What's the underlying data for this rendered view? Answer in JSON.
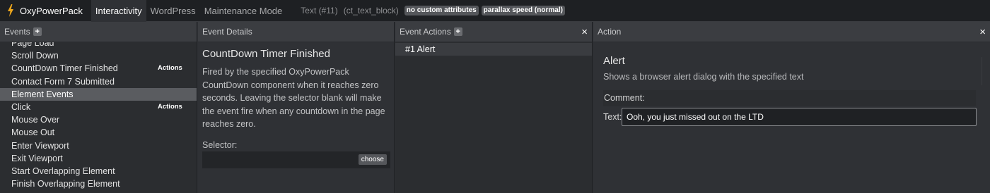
{
  "topbar": {
    "app_name": "OxyPowerPack",
    "tabs": [
      {
        "label": "Interactivity",
        "active": true
      },
      {
        "label": "WordPress",
        "active": false
      },
      {
        "label": "Maintenance Mode",
        "active": false
      }
    ],
    "element_name": "Text (#11)",
    "element_type": "(ct_text_block)",
    "badges": [
      "no custom attributes",
      "parallax speed (normal)"
    ]
  },
  "events_panel": {
    "title": "Events",
    "add_icon": "+",
    "items": [
      {
        "label": "Page Load"
      },
      {
        "label": "Scroll Down"
      },
      {
        "label": "CountDown Timer Finished",
        "tag": "Actions"
      },
      {
        "label": "Contact Form 7 Submitted"
      },
      {
        "label": "Element Events",
        "highlight": true
      },
      {
        "label": "Click",
        "tag": "Actions"
      },
      {
        "label": "Mouse Over"
      },
      {
        "label": "Mouse Out"
      },
      {
        "label": "Enter Viewport"
      },
      {
        "label": "Exit Viewport"
      },
      {
        "label": "Start Overlapping Element"
      },
      {
        "label": "Finish Overlapping Element"
      }
    ]
  },
  "details_panel": {
    "title": "Event Details",
    "event_title": "CountDown Timer Finished",
    "description": "Fired by the specified OxyPowerPack CountDown component when it reaches zero seconds. Leaving the selector blank will make the event fire when any countdown in the page reaches zero.",
    "selector_label": "Selector:",
    "selector_value": "",
    "choose_label": "choose"
  },
  "event_actions_panel": {
    "title": "Event Actions",
    "add_icon": "+",
    "close_icon": "×",
    "items": [
      "#1 Alert"
    ]
  },
  "action_panel": {
    "title": "Action",
    "close_icon": "×",
    "action_title": "Alert",
    "action_desc": "Shows a browser alert dialog with the specified text",
    "comment_label": "Comment:",
    "text_label": "Text:",
    "text_value": "Ooh, you just missed out on the LTD"
  },
  "colors": {
    "bolt": "#f0a81c",
    "highlight": "#5a5c60",
    "background": "#2f3135"
  }
}
